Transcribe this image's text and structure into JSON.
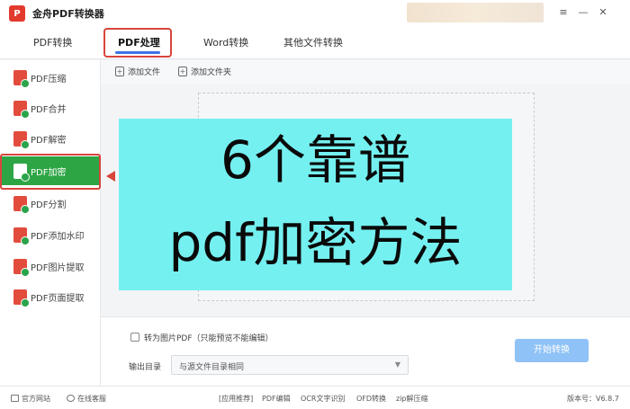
{
  "app": {
    "title": "金舟PDF转换器",
    "logo_text": "P"
  },
  "window_controls": {
    "menu": "≡",
    "minimize": "—",
    "close": "✕"
  },
  "tabs": [
    {
      "label": "PDF转换"
    },
    {
      "label": "PDF处理"
    },
    {
      "label": "Word转换"
    },
    {
      "label": "其他文件转换"
    }
  ],
  "sidebar": {
    "items": [
      {
        "label": "PDF压缩"
      },
      {
        "label": "PDF合并"
      },
      {
        "label": "PDF解密"
      },
      {
        "label": "PDF加密"
      },
      {
        "label": "PDF分割"
      },
      {
        "label": "PDF添加水印"
      },
      {
        "label": "PDF图片提取"
      },
      {
        "label": "PDF页面提取"
      }
    ],
    "active_index": 3
  },
  "toolbar": {
    "add_file": "添加文件",
    "add_folder": "添加文件夹"
  },
  "overlay": {
    "line1": "6个靠谱",
    "line2": "pdf加密方法"
  },
  "options": {
    "checkbox_label": "转为图片PDF（只能预览不能编辑）",
    "output_label": "输出目录",
    "output_value": "与源文件目录相同",
    "start_button": "开始转换"
  },
  "status": {
    "website": "官方网站",
    "support": "在线客服",
    "recommend": "[应用推荐]",
    "links": [
      "PDF编辑",
      "OCR文字识别",
      "OFD转换",
      "zip解压缩"
    ],
    "version": "版本号：V6.8.7"
  },
  "colors": {
    "accent": "#3a73e6",
    "active_green": "#2ea545",
    "highlight_red": "#d8453b",
    "overlay_cyan": "#75f0f0",
    "start_button": "#8fc2f6"
  }
}
